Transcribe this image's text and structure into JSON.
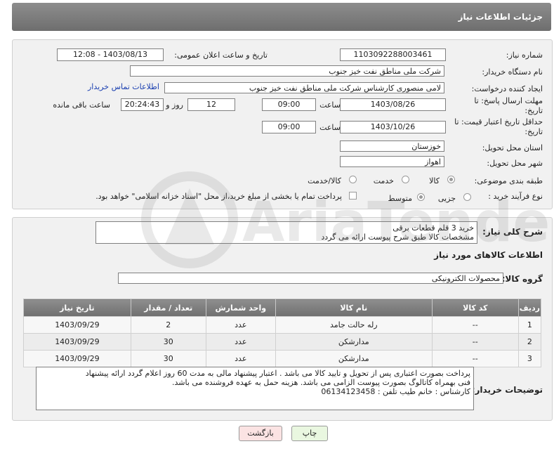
{
  "header": {
    "title": "جزئیات اطلاعات نیاز"
  },
  "form": {
    "need_number_label": "شماره نیاز:",
    "need_number_value": "1103092288003461",
    "announce_label": "تاریخ و ساعت اعلان عمومی:",
    "announce_value": "1403/08/13 - 12:08",
    "buyer_org_label": "نام دستگاه خریدار:",
    "buyer_org_value": "شرکت ملی مناطق نفت خیز جنوب",
    "creator_label": "ایجاد کننده درخواست:",
    "creator_value": "لامی منصوری کارشناس شرکت ملی مناطق نفت خیز جنوب",
    "contact_link": "اطلاعات تماس خریدار",
    "reply_deadline_label_1": "مهلت ارسال پاسخ: تا",
    "reply_deadline_label_2": "تاریخ:",
    "reply_date": "1403/08/26",
    "time_label": "ساعت",
    "reply_time": "09:00",
    "days_value": "12",
    "days_label": "روز و",
    "remaining_value": "20:24:43",
    "remaining_label": "ساعت باقی مانده",
    "price_validity_label_1": "حداقل تاریخ اعتبار قیمت: تا",
    "price_validity_label_2": "تاریخ:",
    "price_date": "1403/10/26",
    "price_time": "09:00",
    "province_label": "استان محل تحویل:",
    "province_value": "خوزستان",
    "city_label": "شهر محل تحویل:",
    "city_value": "اهواز",
    "category_label": "طبقه بندی موضوعی:",
    "category_options": [
      "کالا",
      "خدمت",
      "کالا/خدمت"
    ],
    "purchase_type_label": "نوع فرآیند خرید :",
    "purchase_options": [
      "جزیی",
      "متوسط"
    ],
    "payment_note": "پرداخت تمام یا بخشی از مبلغ خرید،از محل \"اسناد خزانه اسلامی\" خواهد بود."
  },
  "summary": {
    "label": "شرح کلی نیاز:",
    "line1": "خرید 3 قلم قطعات برقی",
    "line2": "مشخصات کالا طبق شرح پیوست ارائه می گردد"
  },
  "goods": {
    "section_title": "اطلاعات کالاهای مورد نیاز",
    "group_label": "گروه کالا:",
    "group_value": "محصولات الکترونیکی",
    "columns": [
      "ردیف",
      "کد کالا",
      "نام کالا",
      "واحد شمارش",
      "تعداد / مقدار",
      "تاریخ نیاز"
    ],
    "rows": [
      [
        "1",
        "--",
        "رله حالت جامد",
        "عدد",
        "2",
        "1403/09/29"
      ],
      [
        "2",
        "--",
        "مدارشکن",
        "عدد",
        "30",
        "1403/09/29"
      ],
      [
        "3",
        "--",
        "مدارشکن",
        "عدد",
        "30",
        "1403/09/29"
      ]
    ]
  },
  "buyer_notes": {
    "label": "توضیحات خریدار:",
    "line1": "پرداخت بصورت اعتباری پس از تحویل و تایید کالا می باشد . اعتبار پیشنهاد مالی به مدت 60 روز اعلام گردد  ارائه پیشنهاد",
    "line2": "فنی بهمراه کاتالوگ بصورت پیوست الزامی می باشد. هزینه حمل به عهده فروشنده می باشد.",
    "line3": "کارشناس : خانم طیب   تلفن : 06134123458"
  },
  "buttons": {
    "print": "چاپ",
    "back": "بازگشت"
  },
  "watermark": {
    "text": "AriaTender.neT"
  },
  "colors": {
    "header_bg": "#7d7d7d",
    "link": "#1a3fb0",
    "print_btn": "#e9f7e0",
    "back_btn": "#fbe3e3"
  }
}
